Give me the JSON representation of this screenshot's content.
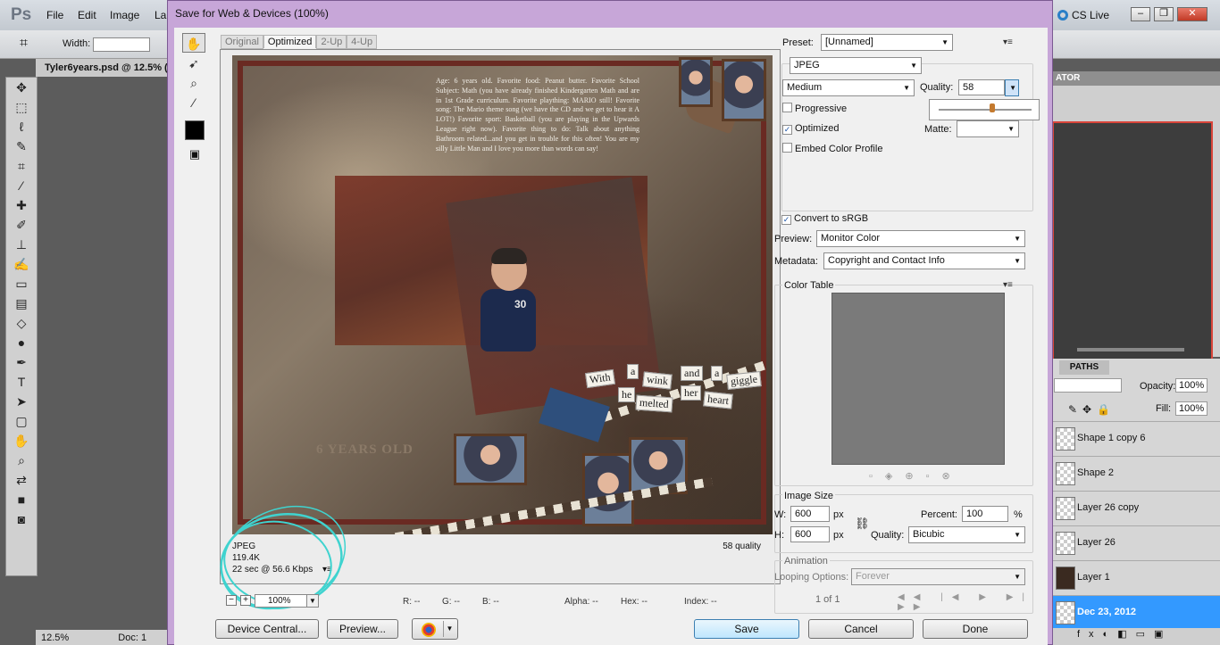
{
  "photoshop": {
    "logo": "Ps",
    "menus": [
      "File",
      "Edit",
      "Image",
      "La"
    ],
    "options_width_label": "Width:",
    "doc_tab": "Tyler6years.psd @ 12.5% (",
    "status_zoom": "12.5%",
    "status_doc": "Doc: 1",
    "cs_live": "CS Live",
    "navigator_tab": "ATOR",
    "paths_tab": "PATHS",
    "opacity_label": "Opacity:",
    "opacity_value": "100%",
    "fill_label": "Fill:",
    "fill_value": "100%",
    "layers": [
      {
        "name": "Shape 1 copy 6",
        "selected": false
      },
      {
        "name": "Shape 2",
        "selected": false
      },
      {
        "name": "Layer 26 copy",
        "selected": false
      },
      {
        "name": "Layer 26",
        "selected": false
      },
      {
        "name": "Layer 1",
        "selected": false
      },
      {
        "name": "Dec 23, 2012",
        "selected": true
      }
    ]
  },
  "dialog": {
    "title": "Save for Web & Devices (100%)",
    "tabs": [
      "Original",
      "Optimized",
      "2-Up",
      "4-Up"
    ],
    "active_tab": "Optimized",
    "image": {
      "journal_text": "Age: 6 years old. Favorite food: Peanut butter. Favorite School Subject: Math (you have already finished Kindergarten Math and are in 1st Grade curriculum. Favorite plaything: MARIO still! Favorite song: The Mario theme song (we have the CD and we get to hear it A LOT!) Favorite sport: Basketball (you are playing in the Upwards League right now). Favorite thing to do: Talk about anything Bathroom related...and you get in trouble for this often! You are my silly Little Man and I love you more than words can say!",
      "title_overlay": "6 YEARS OLD",
      "jersey_number": "30",
      "caption_words": [
        "With",
        "a",
        "wink",
        "and",
        "a",
        "giggle",
        "he",
        "melted",
        "her",
        "heart"
      ]
    },
    "info": {
      "format": "JPEG",
      "size": "119.4K",
      "time": "22 sec @ 56.6 Kbps",
      "quality": "58 quality"
    },
    "zoom": "100%",
    "readout": {
      "r": "R: --",
      "g": "G: --",
      "b": "B: --",
      "alpha": "Alpha: --",
      "hex": "Hex: --",
      "index": "Index: --"
    },
    "buttons": {
      "device_central": "Device Central...",
      "preview": "Preview...",
      "save": "Save",
      "cancel": "Cancel",
      "done": "Done"
    },
    "settings": {
      "preset_label": "Preset:",
      "preset_value": "[Unnamed]",
      "format_value": "JPEG",
      "compression_value": "Medium",
      "quality_label": "Quality:",
      "quality_value": "58",
      "quality_slider_fraction": 0.58,
      "progressive_label": "Progressive",
      "progressive_checked": false,
      "optimized_label": "Optimized",
      "optimized_checked": true,
      "embed_profile_label": "Embed Color Profile",
      "embed_profile_checked": false,
      "matte_label": "Matte:",
      "convert_srgb_label": "Convert to sRGB",
      "convert_srgb_checked": true,
      "preview_label": "Preview:",
      "preview_value": "Monitor Color",
      "metadata_label": "Metadata:",
      "metadata_value": "Copyright and Contact Info",
      "color_table_label": "Color Table",
      "image_size_label": "Image Size",
      "w_label": "W:",
      "w_value": "600",
      "h_label": "H:",
      "h_value": "600",
      "px_unit": "px",
      "percent_label": "Percent:",
      "percent_value": "100",
      "percent_unit": "%",
      "resample_label": "Quality:",
      "resample_value": "Bicubic",
      "animation_label": "Animation",
      "looping_label": "Looping Options:",
      "looping_value": "Forever",
      "frame_counter": "1 of 1"
    }
  },
  "colors": {
    "dialog_frame": "#c7a6d8",
    "primary_button": "#bee6fd",
    "selected_layer": "#3399ff",
    "annotation_circle": "#3fd3cf"
  }
}
